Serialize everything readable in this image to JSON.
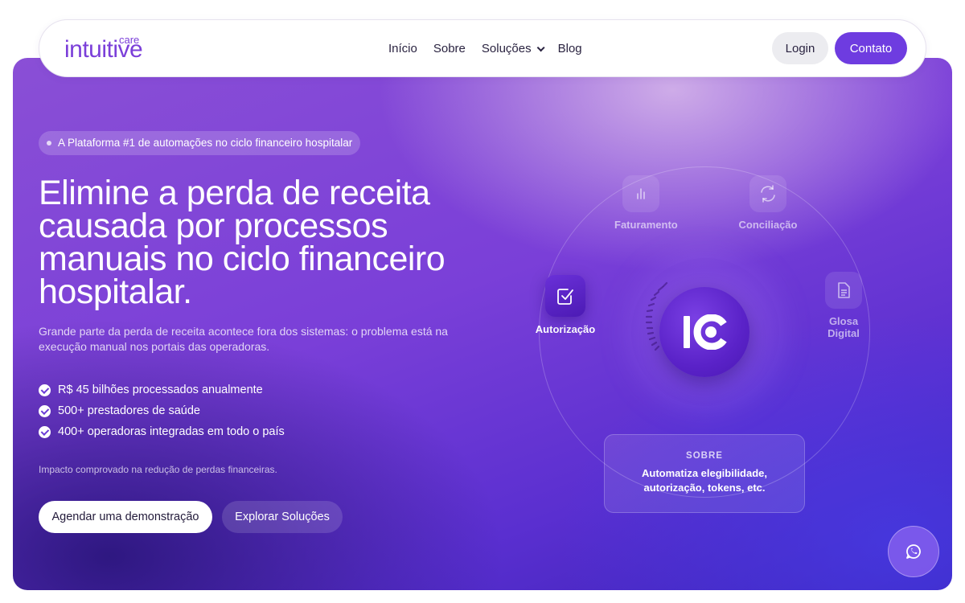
{
  "nav": {
    "logo_main": "intuitive",
    "logo_sub": "care",
    "links": [
      "Início",
      "Sobre",
      "Soluções",
      "Blog"
    ],
    "login": "Login",
    "contato": "Contato"
  },
  "hero": {
    "badge": "A Plataforma #1 de automações no ciclo financeiro hospitalar",
    "headline": "Elimine a perda de receita causada por processos manuais no ciclo financeiro hospitalar.",
    "subtitle": "Grande parte da perda de receita acontece fora dos sistemas: o problema está na execução manual nos portais das operadoras.",
    "checks": [
      "R$ 45 bilhões processados anualmente",
      "500+ prestadores de saúde",
      "400+ operadoras integradas em todo o país"
    ],
    "impact": "Impacto comprovado na redução de perdas financeiras.",
    "cta_primary": "Agendar uma demonstração",
    "cta_secondary": "Explorar Soluções"
  },
  "diagram": {
    "nodes": {
      "faturamento": "Faturamento",
      "conciliacao": "Conciliação",
      "autorizacao": "Autorização",
      "glosa_line1": "Glosa",
      "glosa_line2": "Digital"
    },
    "active": "autorizacao",
    "core_logo": "IC",
    "card": {
      "title": "SOBRE",
      "line1": "Automatiza elegibilidade,",
      "line2": "autorização, tokens, etc."
    }
  },
  "icons": {
    "faturamento": "bar-chart-icon",
    "conciliacao": "refresh-icon",
    "autorizacao": "check-square-icon",
    "glosa": "document-icon",
    "whatsapp": "whatsapp-icon"
  },
  "colors": {
    "brand": "#7b3fd9",
    "contact_button": "#6e3ce0"
  }
}
